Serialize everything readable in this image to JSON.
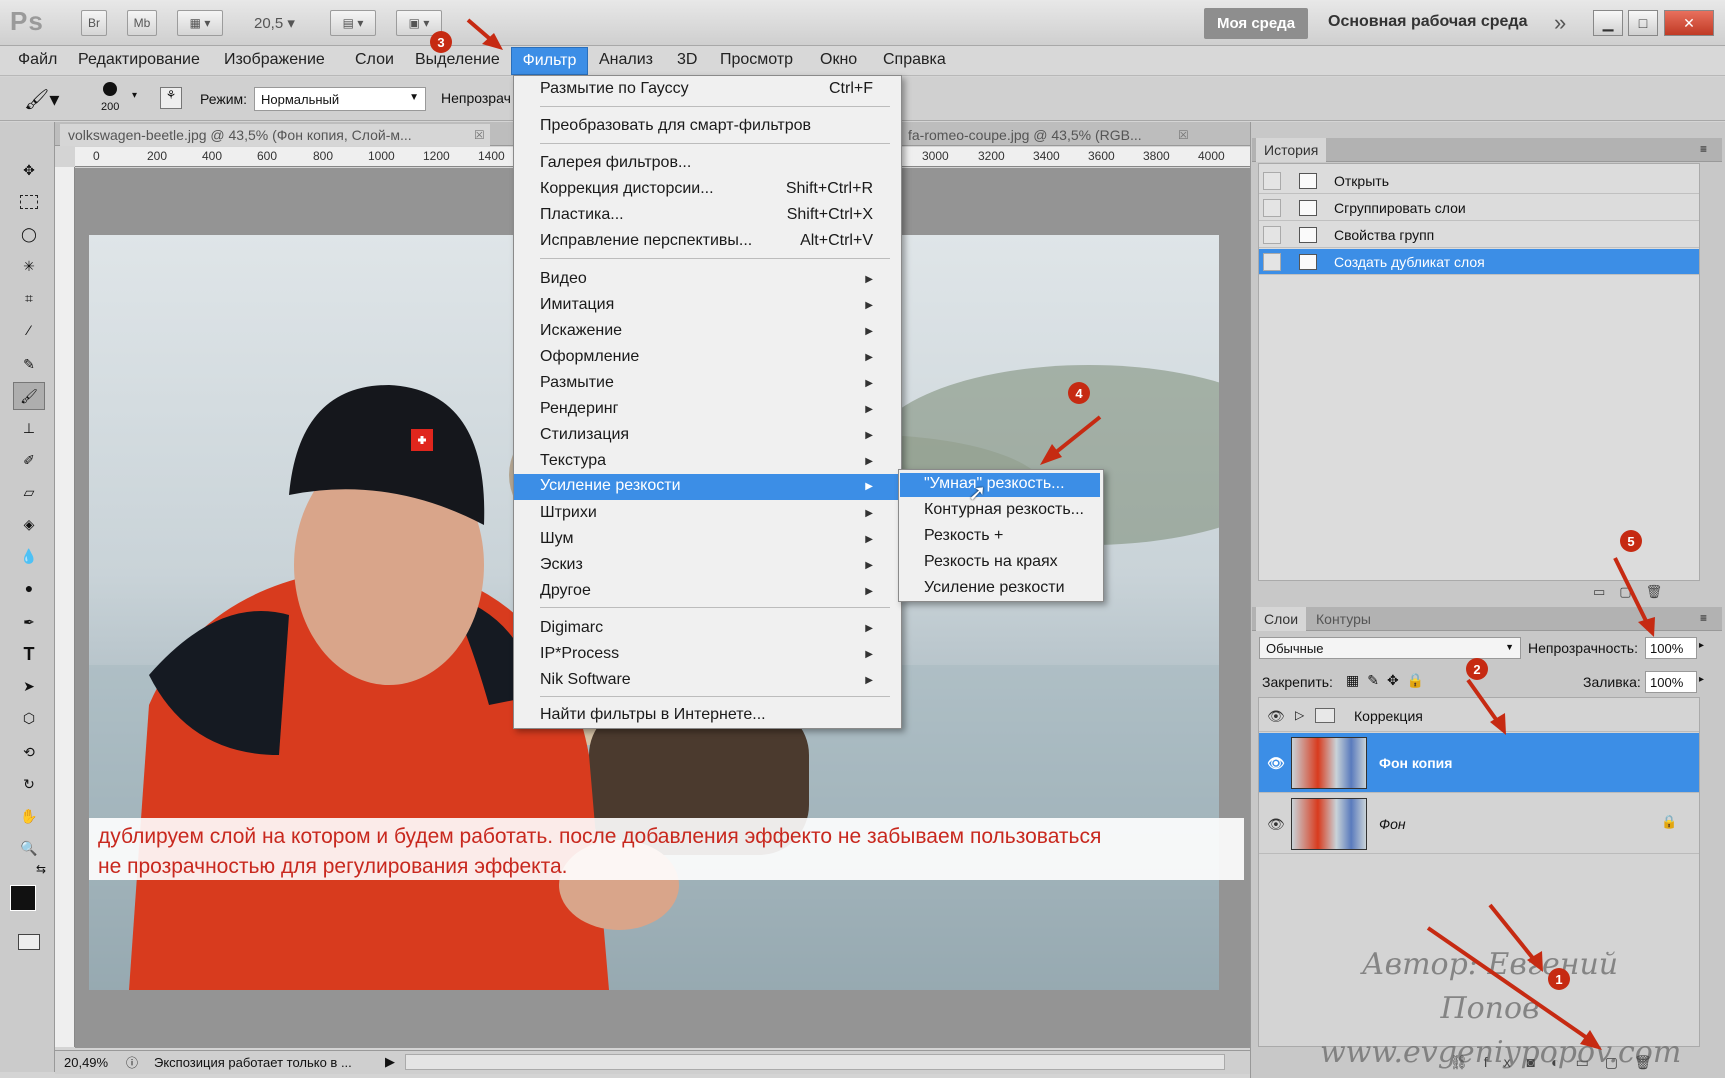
{
  "app": {
    "logo": "Ps"
  },
  "titlebar": {
    "br": "Br",
    "mb": "Mb",
    "zoom": "20,5",
    "workspace_mine": "Моя среда",
    "workspace_main": "Основная рабочая среда",
    "more": "»"
  },
  "menubar": {
    "items": [
      "Файл",
      "Редактирование",
      "Изображение",
      "Слои",
      "Выделение",
      "Фильтр",
      "Анализ",
      "3D",
      "Просмотр",
      "Окно",
      "Справка"
    ]
  },
  "options": {
    "brush_size": "200",
    "mode_label": "Режим:",
    "mode_value": "Нормальный",
    "opacity_label": "Непрозрач"
  },
  "tabs": [
    {
      "label": "volkswagen-beetle.jpg @ 43,5% (Фон копия, Слой-м..."
    },
    {
      "label": "fa-romeo-coupe.jpg @ 43,5% (RGB..."
    }
  ],
  "ruler": {
    "h_ticks": [
      "0",
      "200",
      "400",
      "600",
      "800",
      "1000",
      "1200",
      "1400",
      "3000",
      "3200",
      "3400",
      "3600",
      "3800",
      "4000"
    ]
  },
  "filter_menu": {
    "last_filter": {
      "label": "Размытие по Гауссу",
      "shortcut": "Ctrl+F"
    },
    "smart": "Преобразовать для смарт-фильтров",
    "gallery": [
      {
        "label": "Галерея фильтров...",
        "shortcut": ""
      },
      {
        "label": "Коррекция дисторсии...",
        "shortcut": "Shift+Ctrl+R"
      },
      {
        "label": "Пластика...",
        "shortcut": "Shift+Ctrl+X"
      },
      {
        "label": "Исправление перспективы...",
        "shortcut": "Alt+Ctrl+V"
      }
    ],
    "groups": [
      "Видео",
      "Имитация",
      "Искажение",
      "Оформление",
      "Размытие",
      "Рендеринг",
      "Стилизация",
      "Текстура",
      "Усиление резкости",
      "Штрихи",
      "Шум",
      "Эскиз",
      "Другое"
    ],
    "plugins": [
      "Digimarc",
      "IP*Process",
      "Nik Software"
    ],
    "online": "Найти фильтры в Интернете..."
  },
  "submenu": {
    "items": [
      "\"Умная\" резкость...",
      "Контурная резкость...",
      "Резкость +",
      "Резкость на краях",
      "Усиление резкости"
    ]
  },
  "history": {
    "tab": "История",
    "items": [
      "Открыть",
      "Сгруппировать слои",
      "Свойства групп",
      "Создать дубликат слоя"
    ]
  },
  "layers": {
    "tab_layers": "Слои",
    "tab_paths": "Контуры",
    "blend_mode": "Обычные",
    "opacity_label": "Непрозрачность:",
    "opacity_value": "100%",
    "lock_label": "Закрепить:",
    "fill_label": "Заливка:",
    "fill_value": "100%",
    "rows": [
      "Коррекция",
      "Фон копия",
      "Фон"
    ]
  },
  "caption": {
    "line1": "дублируем слой на котором и будем работать. после добавления эффекто не забываем пользоваться",
    "line2": "не прозрачностью для регулирования эффекта."
  },
  "watermark": {
    "line1": "Автор: Евгений Попов",
    "line2": "www.evgeniypopov.com"
  },
  "status": {
    "zoom": "20,49%",
    "text": "Экспозиция работает только в ..."
  },
  "badges": [
    "1",
    "2",
    "3",
    "4",
    "5"
  ],
  "colors": {
    "accent": "#3c8ee6",
    "annotation": "#c62a12",
    "caption_text": "#c8281e"
  }
}
